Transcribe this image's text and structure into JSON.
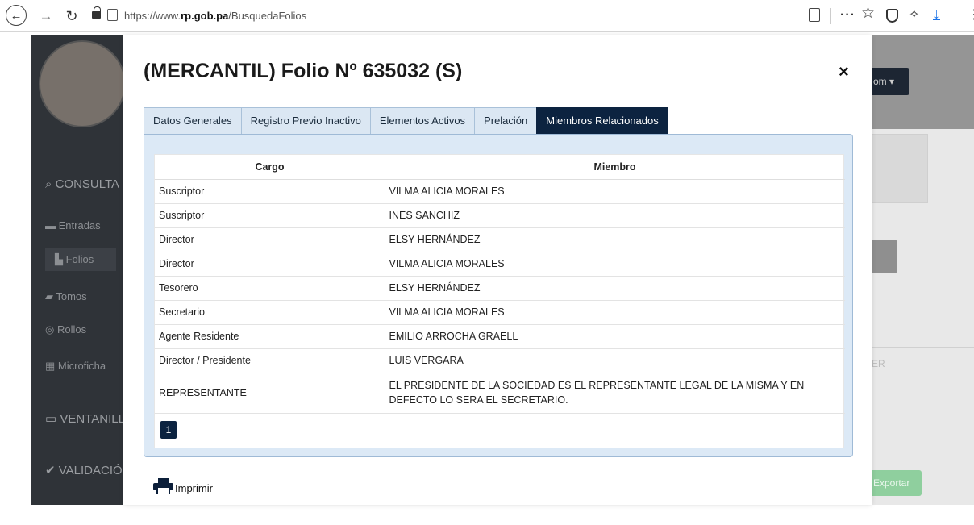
{
  "browser": {
    "url_prefix": "https://www.",
    "url_domain": "rp.gob.pa",
    "url_path": "/BusquedaFolios",
    "more_glyph": "···",
    "star_glyph": "☆",
    "download_glyph": "↓"
  },
  "background": {
    "sidebar": {
      "consultas": "CONSULTA",
      "entradas": "Entradas",
      "folios": "Folios",
      "tomos": "Tomos",
      "rollos": "Rollos",
      "microfichas": "Microficha",
      "ventanilla": "VENTANILL",
      "validacion": "VALIDACIÓ"
    },
    "dropdown_label": "om ▾",
    "er_label": "ER",
    "export_label": "Exportar"
  },
  "modal": {
    "title": "(MERCANTIL) Folio Nº 635032 (S)",
    "close_label": "×",
    "tabs": [
      {
        "label": "Datos Generales",
        "active": false
      },
      {
        "label": "Registro Previo Inactivo",
        "active": false
      },
      {
        "label": "Elementos Activos",
        "active": false
      },
      {
        "label": "Prelación",
        "active": false
      },
      {
        "label": "Miembros Relacionados",
        "active": true
      }
    ],
    "table": {
      "headers": {
        "cargo": "Cargo",
        "miembro": "Miembro"
      },
      "rows": [
        {
          "cargo": "Suscriptor",
          "miembro": "VILMA ALICIA MORALES"
        },
        {
          "cargo": "Suscriptor",
          "miembro": "INES SANCHIZ"
        },
        {
          "cargo": "Director",
          "miembro": "ELSY HERNÁNDEZ"
        },
        {
          "cargo": "Director",
          "miembro": "VILMA ALICIA MORALES"
        },
        {
          "cargo": "Tesorero",
          "miembro": "ELSY HERNÁNDEZ"
        },
        {
          "cargo": "Secretario",
          "miembro": "VILMA ALICIA MORALES"
        },
        {
          "cargo": "Agente Residente",
          "miembro": "EMILIO ARROCHA GRAELL"
        },
        {
          "cargo": "Director / Presidente",
          "miembro": "LUIS VERGARA"
        },
        {
          "cargo": "REPRESENTANTE",
          "miembro": "EL PRESIDENTE DE LA SOCIEDAD ES EL REPRESENTANTE LEGAL DE LA MISMA Y EN DEFECTO LO SERA EL SECRETARIO."
        }
      ]
    },
    "pagination": {
      "current_page": "1"
    },
    "print_label": "Imprimir"
  }
}
